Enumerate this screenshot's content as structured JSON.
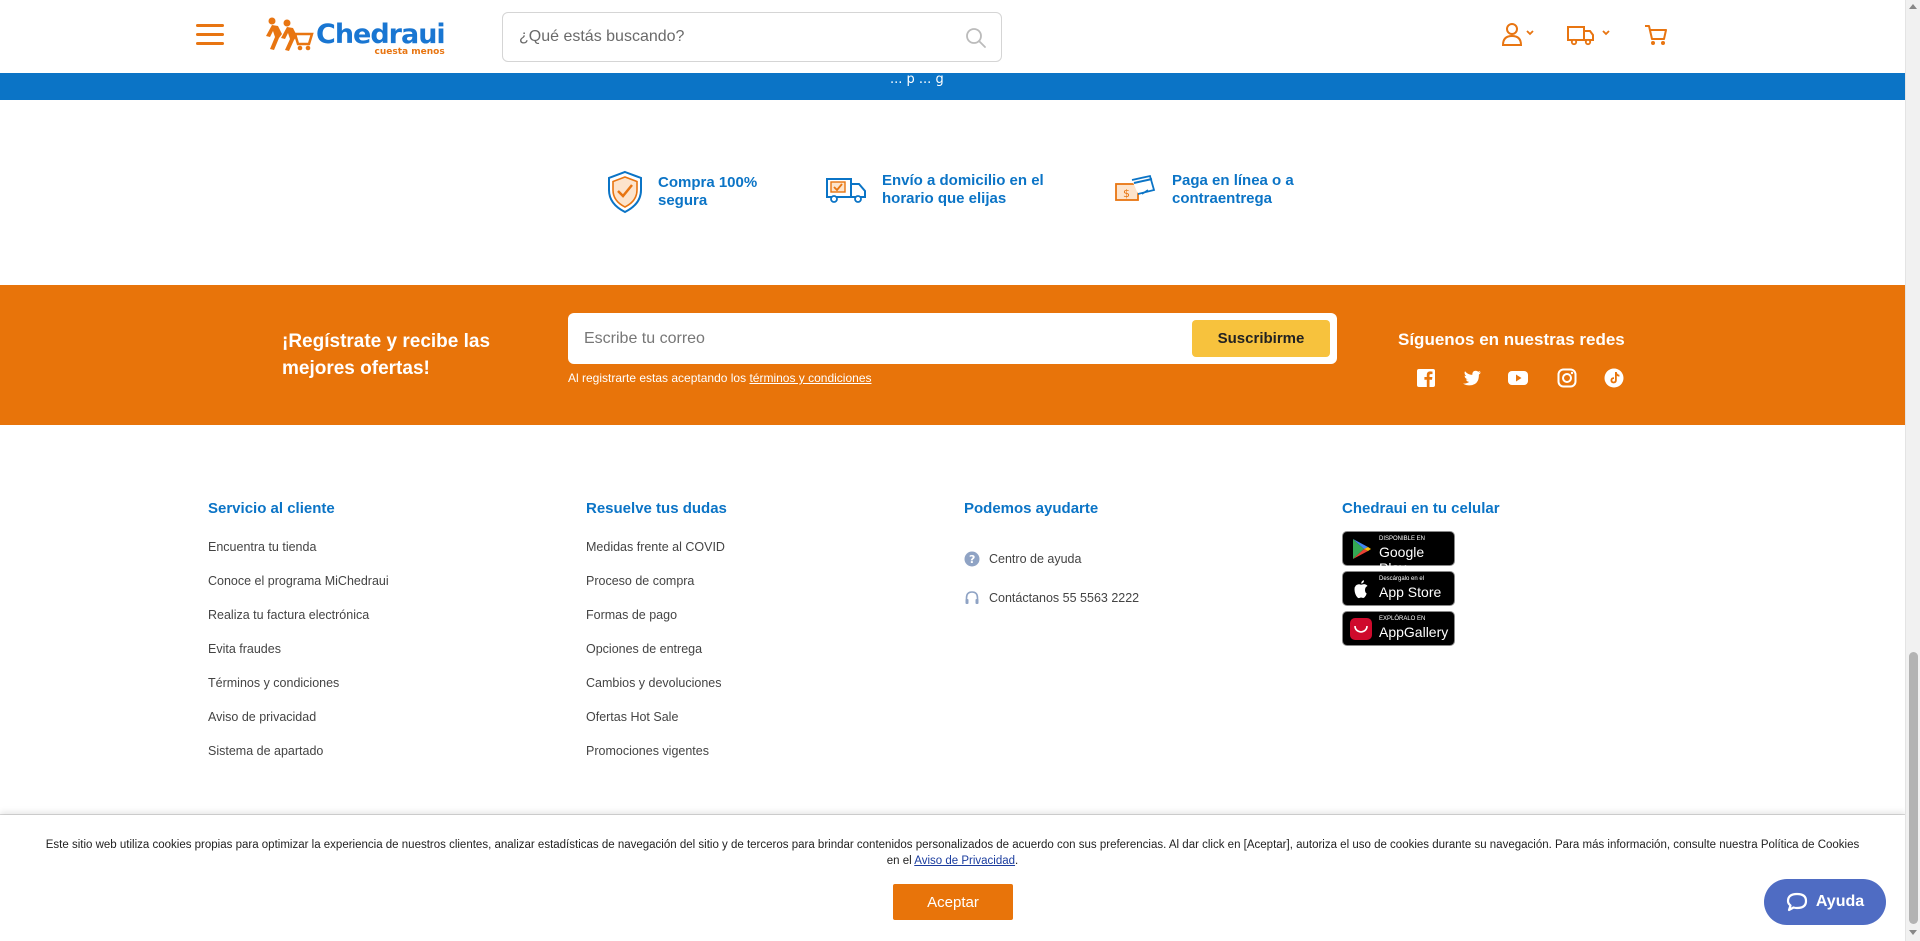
{
  "header": {
    "logo_text": "Chedraui",
    "logo_tagline": "cuesta menos",
    "search_placeholder": "¿Qué estás buscando?",
    "strip_text": "... p ... g"
  },
  "benefits": [
    {
      "icon": "shield-check-icon",
      "line1": "Compra 100%",
      "line2": "segura"
    },
    {
      "icon": "delivery-truck-icon",
      "line1": "Envío a domicilio en el",
      "line2": "horario que elijas"
    },
    {
      "icon": "payment-card-icon",
      "line1": "Paga en línea o a",
      "line2": "contraentrega"
    }
  ],
  "newsletter": {
    "title_line1": "¡Regístrate y recibe las",
    "title_line2": "mejores ofertas!",
    "email_placeholder": "Escribe tu correo",
    "subscribe_label": "Suscribirme",
    "legal_prefix": "Al registrarte estas aceptando los ",
    "legal_link": "términos y condiciones",
    "social_title": "Síguenos en nuestras redes"
  },
  "footer": {
    "col1": {
      "title": "Servicio al cliente",
      "links": [
        "Encuentra tu tienda",
        "Conoce el programa MiChedraui",
        "Realiza tu factura electrónica",
        "Evita fraudes",
        "Términos y condiciones",
        "Aviso de privacidad",
        "Sistema de apartado"
      ]
    },
    "col2": {
      "title": "Resuelve tus dudas",
      "links": [
        "Medidas frente al COVID",
        "Proceso de compra",
        "Formas de pago",
        "Opciones de entrega",
        "Cambios y devoluciones",
        "Ofertas Hot Sale",
        "Promociones vigentes"
      ]
    },
    "col3": {
      "title": "Podemos ayudarte",
      "items": [
        "Centro de ayuda",
        "Contáctanos 55 5563 2222"
      ]
    },
    "col4": {
      "title": "Chedraui en tu celular",
      "badges": [
        {
          "small": "DISPONIBLE EN",
          "big": "Google Play"
        },
        {
          "small": "Descárgalo en el",
          "big": "App Store"
        },
        {
          "small": "EXPLÓRALO EN",
          "big": "AppGallery"
        }
      ]
    }
  },
  "cookie": {
    "text": "Este sitio web utiliza cookies propias para optimizar la experiencia de nuestros clientes, analizar estadísticas de navegación del sitio y de terceros para brindar contenidos personalizados de acuerdo con sus preferencias. Al dar click en [Aceptar], autoriza el uso de cookies durante su navegación. Para más información, consulte nuestra Política de Cookies en el ",
    "link": "Aviso de Privacidad",
    "accept_label": "Aceptar",
    "help_label": "Ayuda"
  },
  "colors": {
    "brand_orange": "#e8740a",
    "brand_blue": "#0b74c6",
    "subscribe_yellow": "#f7c23d",
    "help_button": "#4f6cc3"
  }
}
